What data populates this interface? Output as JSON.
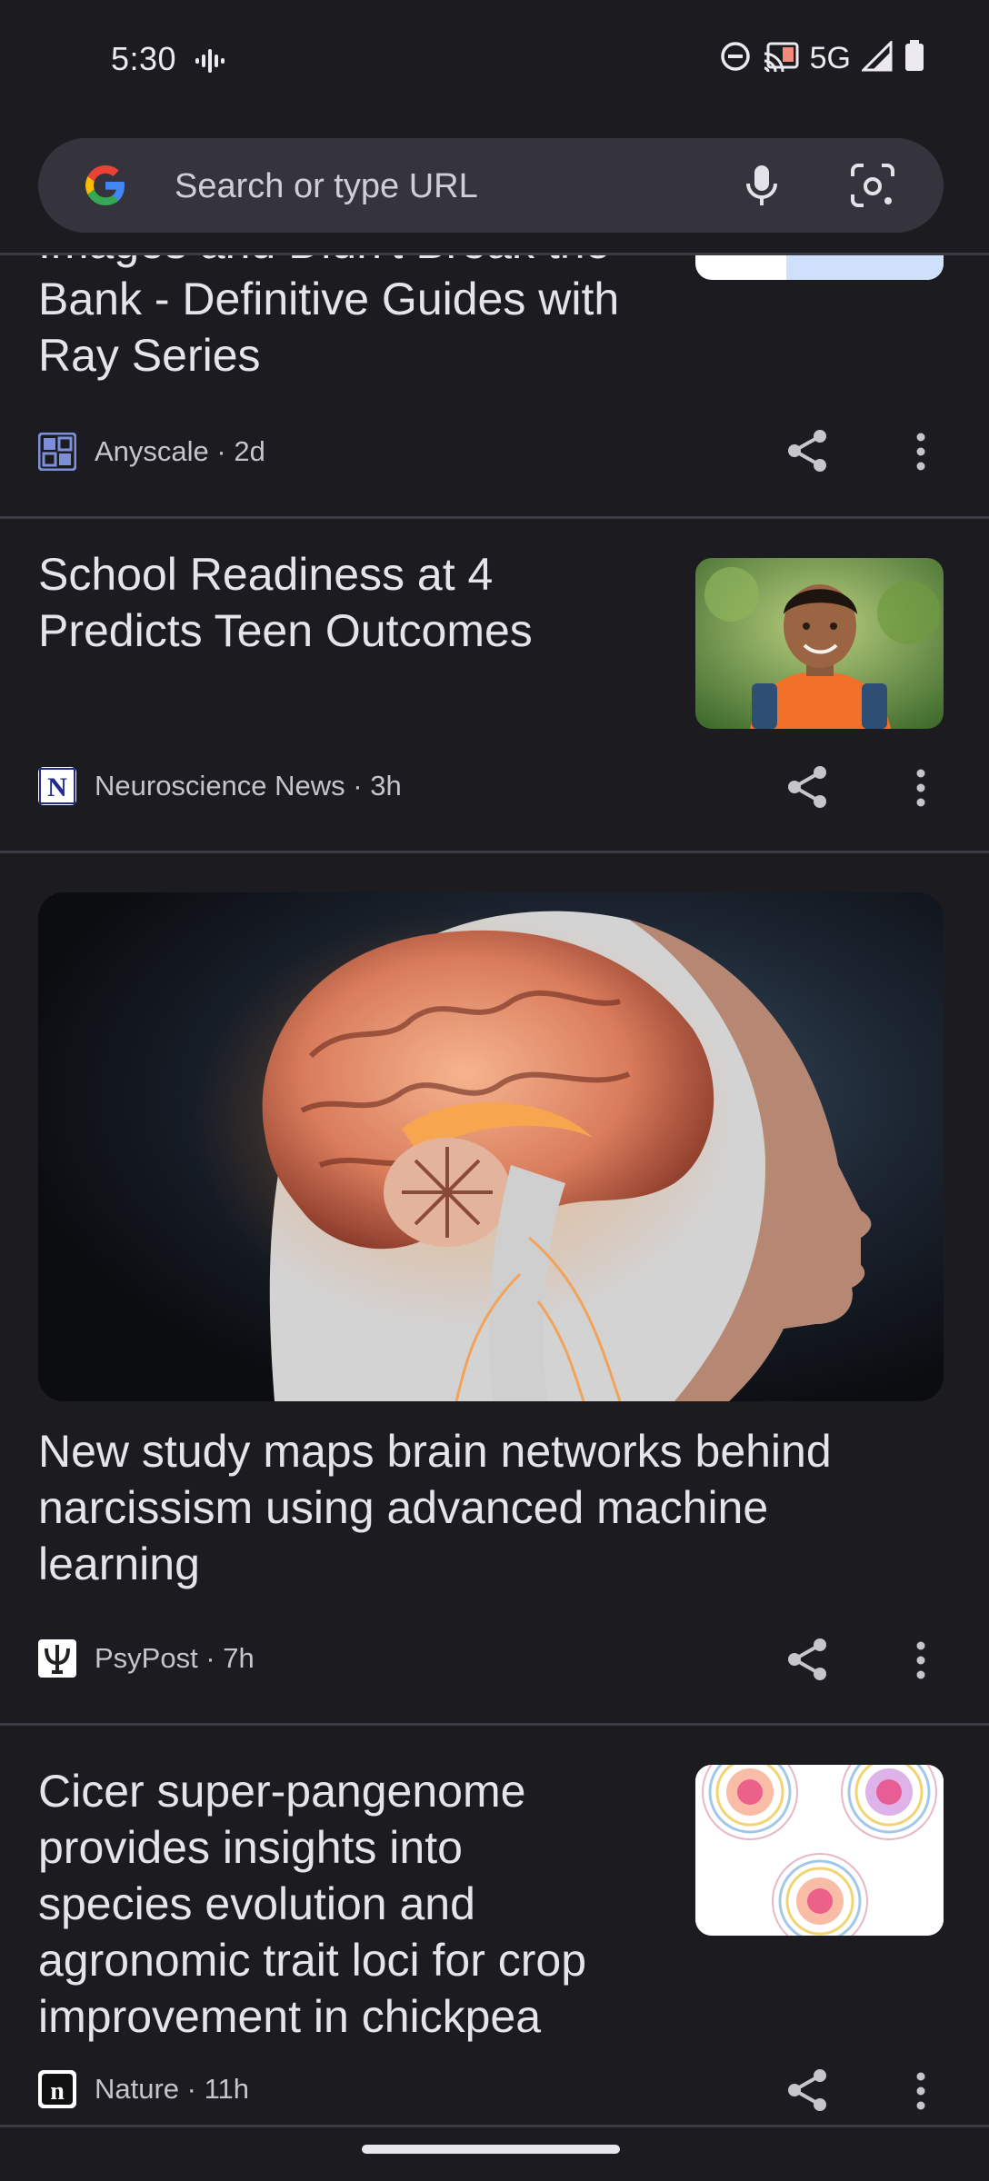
{
  "status_bar": {
    "time": "5:30",
    "network": "5G",
    "icons": [
      "vibrate-icon",
      "do-not-disturb-icon",
      "cast-icon",
      "signal-icon",
      "battery-icon"
    ]
  },
  "search": {
    "placeholder": "Search or type URL",
    "icons": [
      "google-logo",
      "mic-icon",
      "lens-icon"
    ]
  },
  "articles": [
    {
      "title_lines": [
        "Images and Didn't Break the",
        "Bank - Definitive Guides with",
        "Ray Series"
      ],
      "source": "Anyscale · 2d",
      "has_thumbnail": true
    },
    {
      "title_lines": [
        "School Readiness at 4",
        "Predicts Teen Outcomes"
      ],
      "source": "Neuroscience News · 3h",
      "has_thumbnail": true
    },
    {
      "title_lines": [
        "New study maps brain networks behind",
        "narcissism using advanced machine",
        "learning"
      ],
      "source": "PsyPost · 7h",
      "has_hero_image": true
    },
    {
      "title_lines": [
        "Cicer super-pangenome",
        "provides insights into",
        "species evolution and",
        "agronomic trait loci for crop",
        "improvement in chickpea"
      ],
      "source": "Nature · 11h",
      "has_thumbnail": true
    }
  ],
  "colors": {
    "background": "#1c1b20",
    "search_bar": "#35343c",
    "text": "#e6e4ea",
    "meta_text": "#c6c4cc"
  }
}
